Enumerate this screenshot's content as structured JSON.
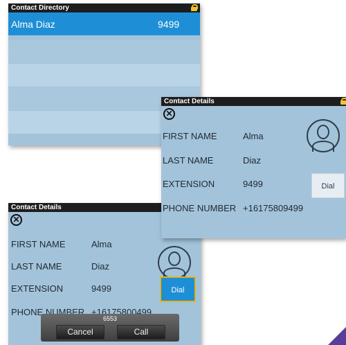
{
  "directory": {
    "title": "Contact Directory",
    "contacts": [
      {
        "name": "Alma Diaz",
        "extension": "9499"
      }
    ]
  },
  "details_front": {
    "title": "Contact Details",
    "fields": [
      {
        "label": "FIRST NAME",
        "value": "Alma"
      },
      {
        "label": "LAST NAME",
        "value": "Diaz"
      },
      {
        "label": "EXTENSION",
        "value": "9499"
      },
      {
        "label": "PHONE NUMBER",
        "value": "+16175809499"
      }
    ],
    "dial_label": "Dial"
  },
  "details_back": {
    "title": "Contact Details",
    "fields": [
      {
        "label": "FIRST NAME",
        "value": "Alma"
      },
      {
        "label": "LAST NAME",
        "value": "Diaz"
      },
      {
        "label": "EXTENSION",
        "value": "9499"
      },
      {
        "label": "PHONE NUMBER",
        "value": "+16175800499"
      }
    ],
    "dial_label": "Dial"
  },
  "call_dialog": {
    "number": "6553",
    "cancel_label": "Cancel",
    "call_label": "Call"
  },
  "colors": {
    "panel_bg": "#a3c3da",
    "titlebar_bg": "#1d1d1f",
    "selected_row": "#1e8fd6",
    "lock": "#f2c230",
    "dial_focus_border": "#e8b31b"
  }
}
